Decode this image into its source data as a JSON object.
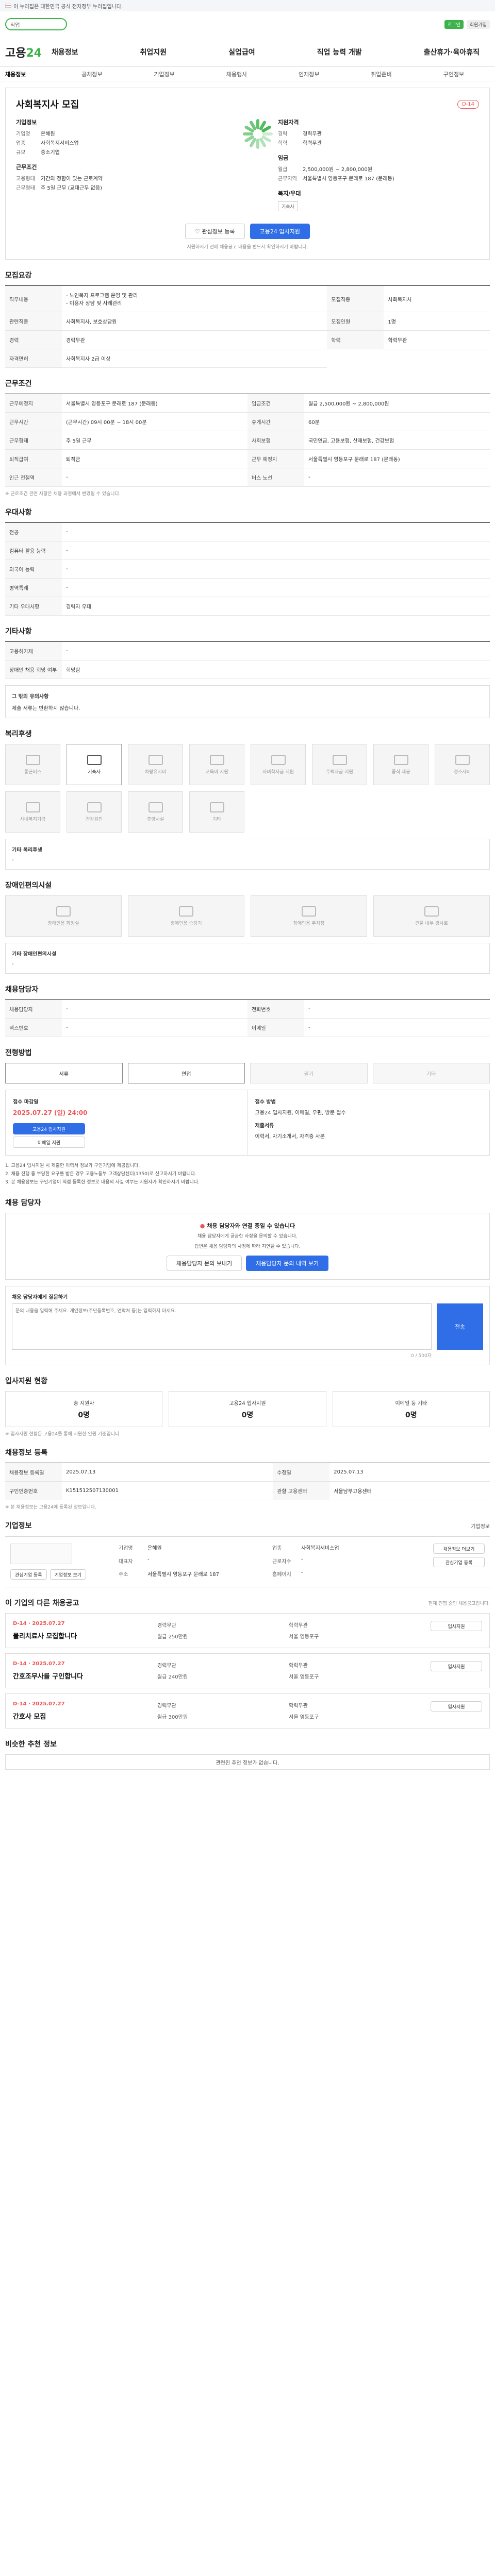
{
  "banner": {
    "text": "이 누리집은 대한민국 공식 전자정부 누리집입니다."
  },
  "top": {
    "search_placeholder": "직업",
    "login": "로그인",
    "join": "회원가입"
  },
  "gnb": {
    "logo_a": "고용",
    "logo_b": "24",
    "menu": [
      "채용정보",
      "취업지원",
      "실업급여",
      "직업 능력 개발",
      "출산휴가·육아휴직"
    ]
  },
  "subnav": [
    "채용정보",
    "공채정보",
    "기업정보",
    "채용행사",
    "인재정보",
    "취업준비",
    "구인정보"
  ],
  "hero": {
    "title": "사회복지사 모집",
    "dday": "D-14",
    "company_label": "기업정보",
    "company": [
      {
        "k": "기업명",
        "v": "은혜원"
      },
      {
        "k": "업종",
        "v": "사회복지서비스업"
      },
      {
        "k": "규모",
        "v": "중소기업"
      }
    ],
    "cond_label": "근무조건",
    "cond": [
      {
        "k": "고용형태",
        "v": "기간의 정함이 있는 근로계약"
      },
      {
        "k": "근무형태",
        "v": "주 5일 근무 (교대근무 없음)"
      }
    ],
    "req_label": "지원자격",
    "req": [
      {
        "k": "경력",
        "v": "경력무관"
      },
      {
        "k": "학력",
        "v": "학력무관"
      }
    ],
    "wage_label": "임금",
    "wage": [
      {
        "k": "월급",
        "v": "2,500,000원 ~ 2,800,000원"
      },
      {
        "k": "근무지역",
        "v": "서울특별시 영등포구 문래로 187 (문래동)"
      }
    ],
    "welfare_label": "복지/우대",
    "welfare_tag": "기숙사",
    "scrap": "관심정보 등록",
    "apply": "고용24 입사지원",
    "notice": "지원하시기 전에 채용공고 내용을 반드시 확인하시기 바랍니다."
  },
  "jobinfo": {
    "title": "모집요강",
    "rows": [
      {
        "k": "직무내용",
        "v": "- 노인복지 프로그램 운영 및 관리\n- 이용자 상담 및 사례관리"
      },
      {
        "k": "모집직종",
        "v": "사회복지사"
      },
      {
        "k": "관련직종",
        "v": "사회복지사, 보호상담원"
      },
      {
        "k": "모집인원",
        "v": "1명"
      },
      {
        "k": "경력",
        "v": "경력무관"
      },
      {
        "k": "학력",
        "v": "학력무관"
      },
      {
        "k": "자격면허",
        "v": "사회복지사 2급 이상"
      }
    ]
  },
  "work": {
    "title": "근무조건",
    "rows": [
      {
        "k": "근무예정지",
        "v": "서울특별시 영등포구 문래로 187 (문래동)"
      },
      {
        "k": "임금조건",
        "v": "월급 2,500,000원 ~ 2,800,000원"
      },
      {
        "k": "근무시간",
        "v": "(근무시간) 09시 00분 ~ 18시 00분"
      },
      {
        "k": "휴게시간",
        "v": "60분"
      },
      {
        "k": "근무형태",
        "v": "주 5일 근무"
      },
      {
        "k": "사회보험",
        "v": "국민연금, 고용보험, 산재보험, 건강보험"
      },
      {
        "k": "퇴직급여",
        "v": "퇴직금"
      },
      {
        "k": "근무 예정지",
        "v": "서울특별시 영등포구 문래로 187 (문래동)"
      },
      {
        "k": "인근 전철역",
        "v": "-"
      },
      {
        "k": "버스 노선",
        "v": "-"
      }
    ],
    "map_btn": "지도 보기",
    "note": "※ 근로조건 관련 사항은 채용 과정에서 변경될 수 있습니다."
  },
  "pref": {
    "title": "우대사항",
    "rows": [
      {
        "k": "전공",
        "v": "-"
      },
      {
        "k": "컴퓨터 활용 능력",
        "v": "-"
      },
      {
        "k": "외국어 능력",
        "v": "-"
      },
      {
        "k": "병역특례",
        "v": "-"
      },
      {
        "k": "기타 우대사항",
        "v": "경력자 우대"
      }
    ]
  },
  "etc": {
    "title": "기타사항",
    "rows": [
      {
        "k": "고용허가제",
        "v": "-"
      },
      {
        "k": "장애인 채용 희망 여부",
        "v": "희망함"
      }
    ],
    "box_title": "그 밖의 유의사항",
    "box_text": "제출 서류는 반환하지 않습니다."
  },
  "welfare": {
    "title": "복리후생",
    "items": [
      {
        "label": "통근버스",
        "on": false
      },
      {
        "label": "기숙사",
        "on": true
      },
      {
        "label": "차량유지비",
        "on": false
      },
      {
        "label": "교육비 지원",
        "on": false
      },
      {
        "label": "자녀학자금 지원",
        "on": false
      },
      {
        "label": "주택자금 지원",
        "on": false
      },
      {
        "label": "중식 제공",
        "on": false
      },
      {
        "label": "경조사비",
        "on": false
      }
    ],
    "more_items": [
      {
        "label": "사내복지기금",
        "on": false
      },
      {
        "label": "건강검진",
        "on": false
      },
      {
        "label": "휴양시설",
        "on": false
      },
      {
        "label": "기타",
        "on": false
      }
    ],
    "sub_title": "기타 복리후생",
    "sub_text": "-"
  },
  "facility": {
    "title": "장애인편의시설",
    "items": [
      "장애인용 화장실",
      "장애인용 승강기",
      "장애인용 주차장",
      "건물 내부 경사로"
    ],
    "sub_title": "기타 장애인편의시설",
    "sub_text": "-"
  },
  "recruiter": {
    "title": "채용담당자",
    "rows": [
      {
        "k": "채용담당자",
        "v": "-"
      },
      {
        "k": "전화번호",
        "v": "-"
      },
      {
        "k": "팩스번호",
        "v": "-"
      },
      {
        "k": "이메일",
        "v": "-"
      }
    ]
  },
  "hire": {
    "title": "전형방법",
    "tabs": [
      {
        "label": "서류",
        "on": true
      },
      {
        "label": "면접",
        "on": true
      },
      {
        "label": "필기",
        "on": false
      },
      {
        "label": "기타",
        "on": false
      }
    ]
  },
  "applybox": {
    "period_label": "접수 마감일",
    "deadline": "2025.07.27 (일) 24:00",
    "apply_btn": "고용24 입사지원",
    "email_btn": "이메일 지원",
    "method_label": "접수 방법",
    "method_text": "고용24 입사지원, 이메일, 우편, 방문 접수",
    "doc_label": "제출서류",
    "doc_text": "이력서, 자기소개서, 자격증 사본"
  },
  "fineprint": {
    "lines": [
      "1. 고용24 입사지원 시 제출한 이력서 정보가 구인기업에 제공됩니다.",
      "2. 채용 진행 중 부당한 요구를 받은 경우 고용노동부 고객상담센터(1350)로 신고하시기 바랍니다.",
      "3. 본 채용정보는 구인기업이 직접 등록한 정보로 내용의 사실 여부는 지원자가 확인하시기 바랍니다."
    ]
  },
  "ai": {
    "title": "채용 담당자",
    "warn": "채용 담당자와 연결 중일 수 있습니다",
    "p1": "채용 담당자에게 궁금한 사항을 문의할 수 있습니다.",
    "p2": "답변은 채용 담당자의 사정에 따라 지연될 수 있습니다.",
    "btn1": "채용담당자 문의 보내기",
    "btn2": "채용담당자 문의 내역 보기"
  },
  "inquiry": {
    "label": "채용 담당자에게 질문하기",
    "placeholder": "문의 내용을 입력해 주세요. 개인정보(주민등록번호, 연락처 등)는 입력하지 마세요.",
    "send": "전송",
    "counter": "0 / 500자"
  },
  "stats": {
    "title": "입사지원 현황",
    "items": [
      {
        "label": "총 지원자",
        "num": "0명"
      },
      {
        "label": "고용24 입사지원",
        "num": "0명"
      },
      {
        "label": "이메일 등 기타",
        "num": "0명"
      }
    ],
    "note": "※ 입사지원 현황은 고용24를 통해 지원한 인원 기준입니다."
  },
  "regi": {
    "title": "채용정보 등록",
    "rows": [
      {
        "k": "채용정보 등록일",
        "v": "2025.07.13"
      },
      {
        "k": "수정일",
        "v": "2025.07.13"
      },
      {
        "k": "구인인증번호",
        "v": "K151512507130001"
      },
      {
        "k": "관할 고용센터",
        "v": "서울남부고용센터"
      }
    ],
    "note": "※ 본 채용정보는 고용24에 등록된 정보입니다."
  },
  "company": {
    "title": "기업정보",
    "more": "기업정보",
    "btn_a": "관심기업 등록",
    "btn_b": "기업정보 보기",
    "fields": [
      {
        "k": "기업명",
        "v": "은혜원"
      },
      {
        "k": "업종",
        "v": "사회복지서비스업"
      },
      {
        "k": "대표자",
        "v": "-"
      },
      {
        "k": "근로자수",
        "v": "-"
      },
      {
        "k": "주소",
        "v": "서울특별시 영등포구 문래로 187"
      },
      {
        "k": "홈페이지",
        "v": "-"
      }
    ],
    "side_a": "채용정보 더보기",
    "side_b": "관심기업 등록"
  },
  "postings": {
    "title": "이 기업의 다른 채용공고",
    "note": "현재 진행 중인 채용공고입니다.",
    "items": [
      {
        "dday": "D-14",
        "date": "2025.07.27",
        "title": "물리치료사 모집합니다",
        "meta": [
          "경력무관",
          "학력무관",
          "월급 250만원",
          "서울 영등포구"
        ],
        "btn": "입사지원"
      },
      {
        "dday": "D-14",
        "date": "2025.07.27",
        "title": "간호조무사를 구인합니다",
        "meta": [
          "경력무관",
          "학력무관",
          "월급 240만원",
          "서울 영등포구"
        ],
        "btn": "입사지원"
      },
      {
        "dday": "D-14",
        "date": "2025.07.27",
        "title": "간호사 모집",
        "meta": [
          "경력무관",
          "학력무관",
          "월급 300만원",
          "서울 영등포구"
        ],
        "btn": "입사지원"
      }
    ]
  },
  "similar": {
    "title": "비슷한 추천 정보",
    "empty": "관련된 추천 정보가 없습니다."
  }
}
